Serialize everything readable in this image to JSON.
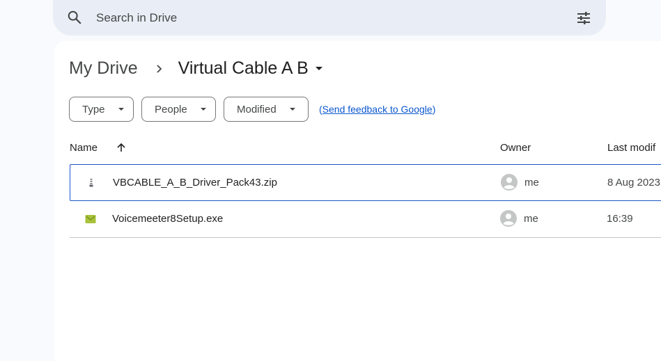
{
  "search": {
    "placeholder": "Search in Drive"
  },
  "breadcrumb": {
    "root": "My Drive",
    "current": "Virtual Cable A B"
  },
  "filters": {
    "chips": [
      "Type",
      "People",
      "Modified"
    ],
    "feedback_prefix": "(",
    "feedback_link": "Send feedback to Google",
    "feedback_suffix": ")"
  },
  "table": {
    "columns": {
      "name": "Name",
      "owner": "Owner",
      "modified": "Last modif"
    },
    "rows": [
      {
        "name": "VBCABLE_A_B_Driver_Pack43.zip",
        "owner": "me",
        "modified": "8 Aug 2023",
        "icon": "zip-file-icon"
      },
      {
        "name": "Voicemeeter8Setup.exe",
        "owner": "me",
        "modified": "16:39",
        "icon": "exe-file-icon"
      }
    ]
  },
  "colors": {
    "accent": "#0b57d0",
    "selection_border": "#1a56c4",
    "search_bg": "#e9eef6",
    "exe_icon": "#a8c23a"
  }
}
